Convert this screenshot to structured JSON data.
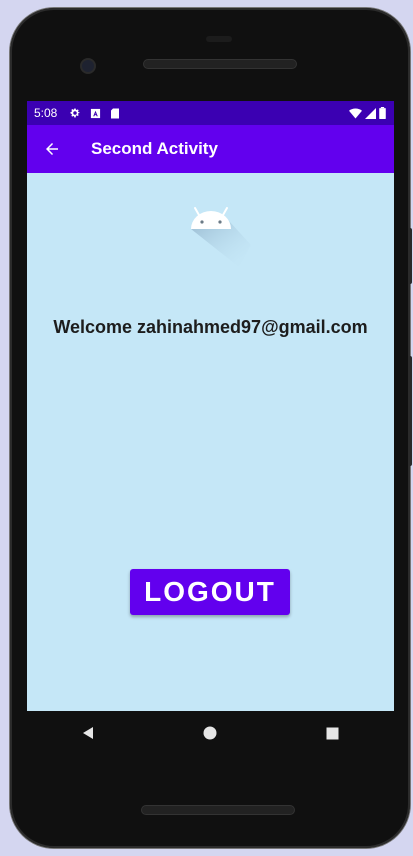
{
  "status_bar": {
    "time": "5:08",
    "left_icons": [
      "settings-icon",
      "a11y-icon",
      "sd-card-icon"
    ],
    "right_icons": [
      "wifi-icon",
      "signal-icon",
      "battery-icon"
    ],
    "background": "#3b00b2"
  },
  "app_bar": {
    "title": "Second Activity",
    "background": "#6200ee"
  },
  "main": {
    "background": "#c5e7f7",
    "welcome_prefix": "Welcome",
    "email": "zahinahmed97@gmail.com",
    "logout_label": "LOGOUT"
  },
  "nav_bar": {
    "buttons": [
      "back-triangle-icon",
      "home-circle-icon",
      "recents-square-icon"
    ]
  }
}
